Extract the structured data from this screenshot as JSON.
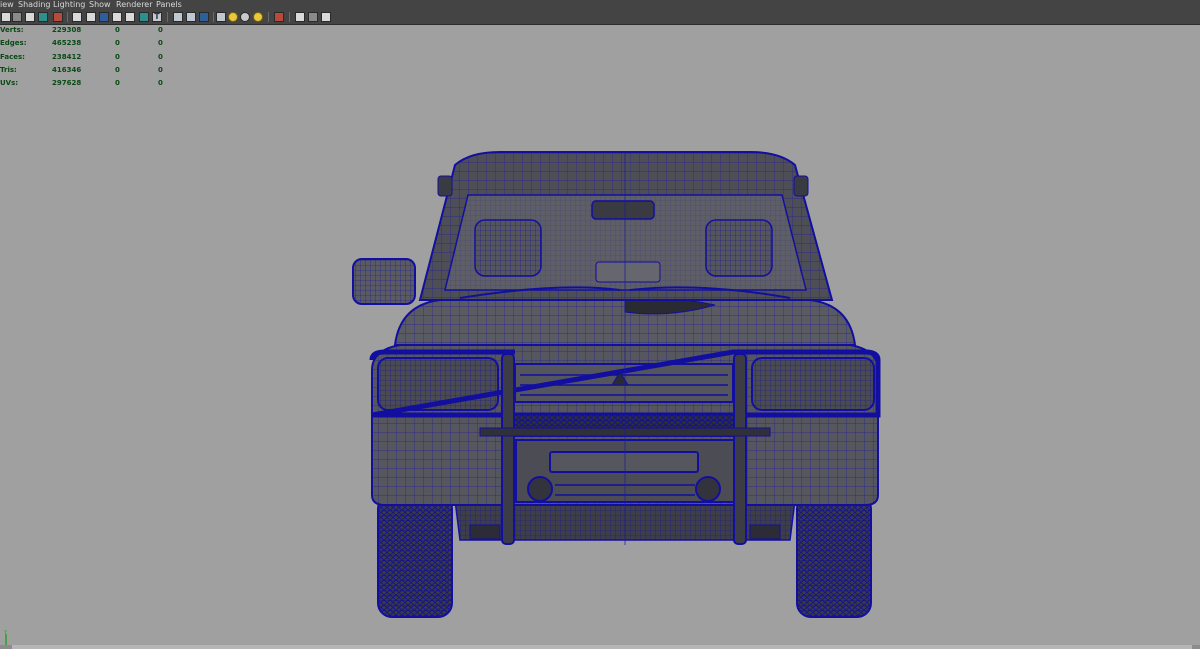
{
  "menu": [
    "iew",
    "Shading",
    "Lighting",
    "Show",
    "Renderer",
    "Panels"
  ],
  "toolbar_icons": [
    "select-camera-icon",
    "camera-attributes-icon",
    "bookmark-icon",
    "image-plane-icon",
    "2d-pan-icon",
    "grease-pencil-icon",
    "grid-icon",
    "film-gate-icon",
    "resolution-gate-icon",
    "gate-mask-icon",
    "field-chart-icon",
    "safe-action-icon",
    "safe-title-icon",
    "wireframe-icon",
    "smooth-shade-icon",
    "wireframe-on-shaded-icon",
    "default-lighting-icon",
    "all-lights-icon",
    "shadows-icon",
    "xray-icon",
    "isolate-select-icon",
    "xray-joints-icon",
    "xray-active-icon"
  ],
  "hud": {
    "rows": [
      {
        "label": "Verts:",
        "v1": "229308",
        "v2": "0",
        "v3": "0"
      },
      {
        "label": "Edges:",
        "v1": "465238",
        "v2": "0",
        "v3": "0"
      },
      {
        "label": "Faces:",
        "v1": "238412",
        "v2": "0",
        "v3": "0"
      },
      {
        "label": "Tris:",
        "v1": "416346",
        "v2": "0",
        "v3": "0"
      },
      {
        "label": "UVs:",
        "v1": "297628",
        "v2": "0",
        "v3": "0"
      }
    ]
  },
  "viewport": {
    "background": "#a0a0a0",
    "mesh_color": "#11109a",
    "shade_color": "#4e4e52",
    "model": "vehicle-wireframe-on-shaded"
  },
  "axis": {
    "y": "Y",
    "x": "X",
    "z": "Z"
  }
}
